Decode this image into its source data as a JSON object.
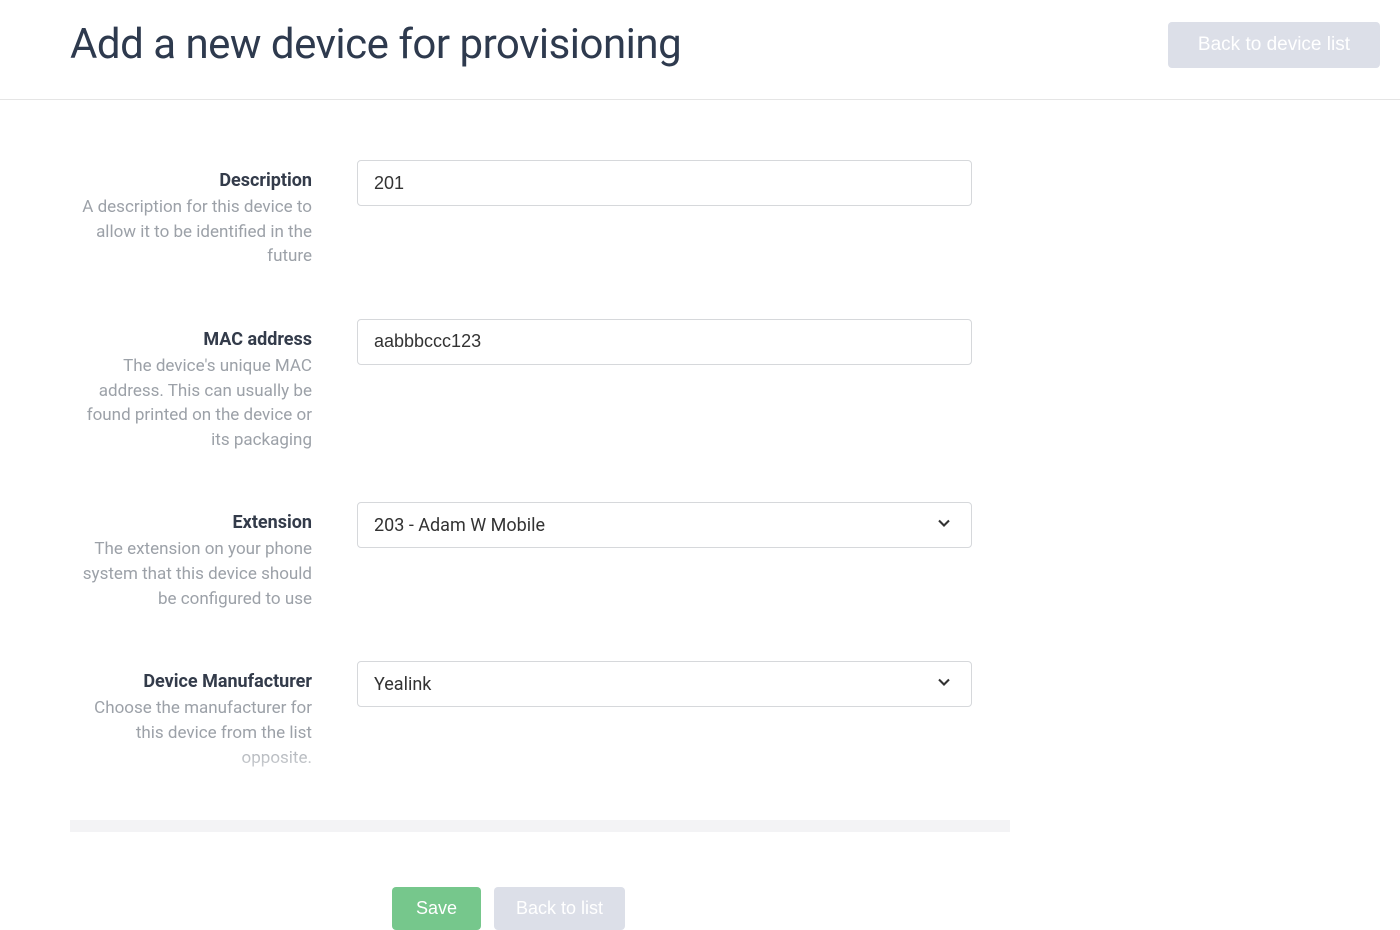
{
  "header": {
    "title": "Add a new device for provisioning",
    "back_button": "Back to device list"
  },
  "form": {
    "description": {
      "label": "Description",
      "help": "A description for this device to allow it to be identified in the future",
      "value": "201"
    },
    "mac_address": {
      "label": "MAC address",
      "help": "The device's unique MAC address. This can usually be found printed on the device or its packaging",
      "value": "aabbbccc123"
    },
    "extension": {
      "label": "Extension",
      "help": "The extension on your phone system that this device should be configured to use",
      "selected": "203 - Adam W Mobile"
    },
    "manufacturer": {
      "label": "Device Manufacturer",
      "help": "Choose the manufacturer for this device from the list opposite.",
      "selected": "Yealink"
    }
  },
  "actions": {
    "save": "Save",
    "back": "Back to list"
  }
}
